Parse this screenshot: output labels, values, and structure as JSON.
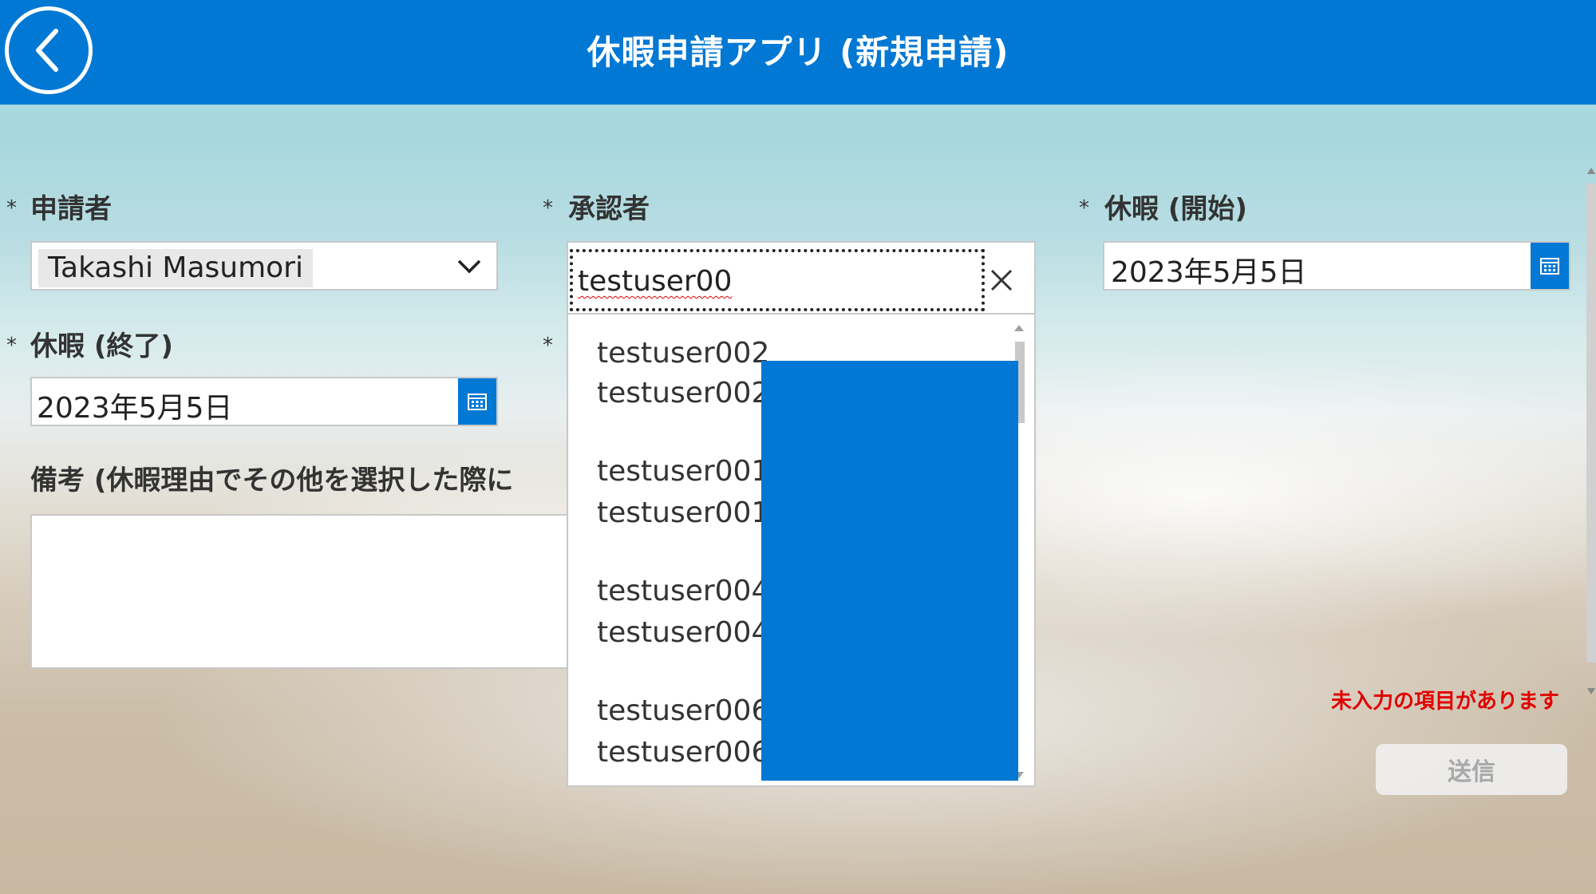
{
  "header": {
    "title": "休暇申請アプリ (新規申請)"
  },
  "form": {
    "applicant": {
      "required_mark": "*",
      "label": "申請者",
      "value": "Takashi Masumori"
    },
    "approver": {
      "required_mark": "*",
      "label": "承認者",
      "search_text": "testuser00"
    },
    "leave_start": {
      "required_mark": "*",
      "label": "休暇 (開始)",
      "value": "2023年5月5日"
    },
    "leave_end": {
      "required_mark": "*",
      "label": "休暇 (終了)",
      "value": "2023年5月5日"
    },
    "hidden_field": {
      "required_mark": "*"
    },
    "remarks": {
      "label": "備考 (休暇理由でその他を選択した際に",
      "value": ""
    }
  },
  "approver_dropdown": {
    "items": [
      {
        "primary": "testuser002",
        "secondary": "testuser002"
      },
      {
        "primary": "testuser001",
        "secondary": "testuser001"
      },
      {
        "primary": "testuser004",
        "secondary": "testuser004"
      },
      {
        "primary": "testuser006",
        "secondary": "testuser006"
      }
    ]
  },
  "validation": {
    "error_message": "未入力の項目があります"
  },
  "actions": {
    "submit_label": "送信"
  },
  "colors": {
    "accent": "#0078d4",
    "error": "#e00000",
    "disabled_text": "#a8a8a8"
  },
  "icons": {
    "back": "chevron-left-icon",
    "dropdown": "chevron-down-icon",
    "calendar": "calendar-icon",
    "clear": "close-icon"
  }
}
